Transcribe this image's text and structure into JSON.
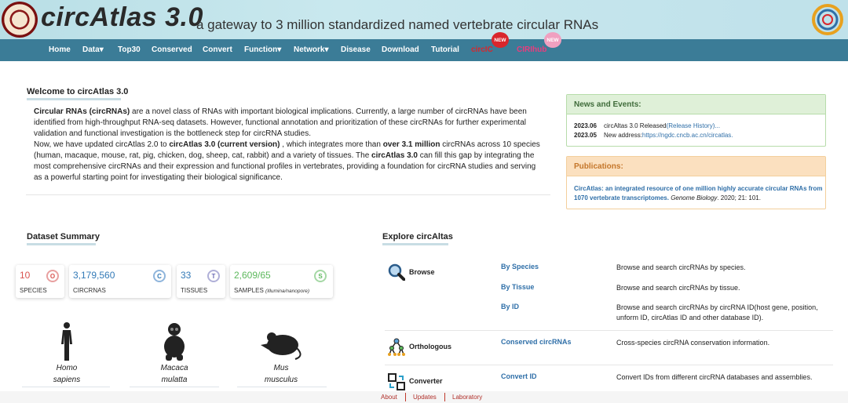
{
  "header": {
    "title": "circAtlas 3.0",
    "tagline": "a gateway to 3 million standardized named vertebrate circular RNAs"
  },
  "nav": {
    "items": [
      "Home",
      "Data",
      "Top30",
      "Conserved",
      "Convert",
      "Function",
      "Network",
      "Disease",
      "Download",
      "Tutorial",
      "circIC",
      "CIRIhub"
    ],
    "badge": "NEW"
  },
  "welcome": {
    "title": "Welcome to circAtlas 3.0",
    "p1_bold": "Circular RNAs (circRNAs)",
    "p1_rest": " are a novel class of RNAs with important biological implications. Currently, a large number of circRNAs have been identified from high-throughput RNA-seq datasets. However, functional annotation and prioritization of these circRNAs for further experimental validation and functional investigation is the bottleneck step for circRNA studies.",
    "p2_a": "Now, we have updated circAtlas 2.0 to ",
    "p2_b": "circAtlas 3.0 (current version)",
    "p2_c": " , which integrates more than ",
    "p2_d": "over 3.1 million",
    "p2_e": " circRNAs across 10 species (human, macaque, mouse, rat, pig, chicken, dog, sheep, cat, rabbit) and a variety of tissues. The ",
    "p2_f": "circAtlas 3.0",
    "p2_g": " can fill this gap by integrating the most comprehensive circRNAs and their expression and functional profiles in vertebrates, providing a foundation for circRNA studies and serving as a powerful starting point for investigating their biological significance."
  },
  "news": {
    "title": "News and Events:",
    "items": [
      {
        "date": "2023.06",
        "text": "circAltas 3.0 Released",
        "link": "(Release History)..."
      },
      {
        "date": "2023.05",
        "text": "New address:",
        "link": "https://ngdc.cncb.ac.cn/circatlas."
      }
    ]
  },
  "publications": {
    "title": "Publications:",
    "link": "CircAtlas: an integrated resource of one million highly accurate circular RNAs from 1070 vertebrate transcriptomes.",
    "journal": "Genome Biology",
    "citation": ". 2020; 21: 101."
  },
  "dataset": {
    "title": "Dataset Summary",
    "stats": [
      {
        "value": "10",
        "label": "SPECIES",
        "icon": "O",
        "color": "#d9534f"
      },
      {
        "value": "3,179,560",
        "label": "CIRCRNAS",
        "icon": "C",
        "color": "#337ab7"
      },
      {
        "value": "33",
        "label": "TISSUES",
        "icon": "T",
        "color": "#6b6bb5"
      },
      {
        "value": "2,609/65",
        "label": "SAMPLES",
        "label_small": "(Illumina/nanopore)",
        "icon": "S",
        "color": "#5cb85c"
      }
    ],
    "species": [
      {
        "line1": "Homo",
        "line2": "sapiens",
        "icon": "human-silhouette-icon"
      },
      {
        "line1": "Macaca",
        "line2": "mulatta",
        "icon": "macaque-silhouette-icon"
      },
      {
        "line1": "Mus",
        "line2": "musculus",
        "icon": "mouse-silhouette-icon"
      }
    ]
  },
  "explore": {
    "title": "Explore circAltas",
    "browse": {
      "label": "Browse",
      "links": [
        {
          "name": "By Species",
          "desc": "Browse and search circRNAs by species."
        },
        {
          "name": "By Tissue",
          "desc": "Browse and search circRNAs by tissue."
        },
        {
          "name": "By ID",
          "desc": "Browse and search circRNAs by circRNA ID(host gene, position, unform ID, circAtlas ID and other database ID)."
        }
      ]
    },
    "orthologous": {
      "label": "Orthologous",
      "link": "Conserved circRNAs",
      "desc": "Cross-species circRNA conservation information."
    },
    "converter": {
      "label": "Converter",
      "link": "Convert ID",
      "desc": "Convert IDs from different circRNA databases and assemblies."
    }
  },
  "footer": {
    "links": [
      "About",
      "Updates",
      "Laboratory"
    ]
  }
}
